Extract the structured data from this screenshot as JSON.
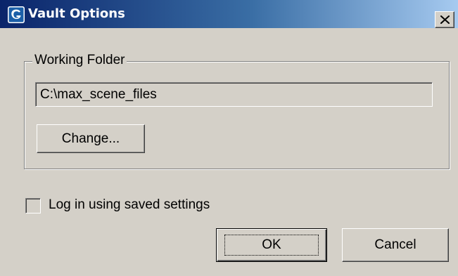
{
  "window": {
    "title": "Vault Options",
    "icon": "3ds-max-app-icon",
    "close_icon": "close-icon"
  },
  "working_folder": {
    "group_label": "Working Folder",
    "path_value": "C:\\max_scene_files",
    "change_button_label": "Change..."
  },
  "login": {
    "checkbox_label": "Log in using saved settings",
    "checked": false
  },
  "buttons": {
    "ok_label": "OK",
    "cancel_label": "Cancel"
  },
  "colors": {
    "dialog_face": "#d4d0c8",
    "titlebar_start": "#0a246a",
    "titlebar_end": "#a6caf0",
    "title_text": "#ffffff"
  }
}
